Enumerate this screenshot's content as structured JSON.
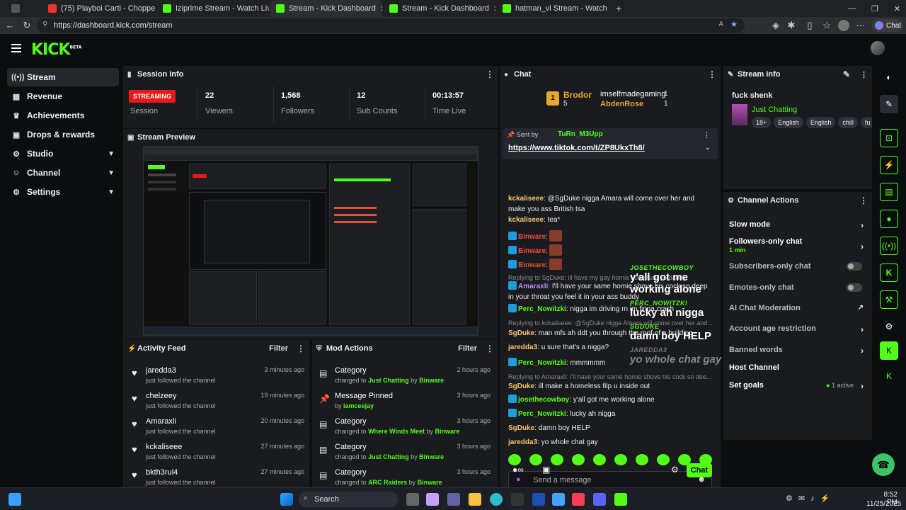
{
  "browser": {
    "tabs": [
      "(75) Playboi Carti - Chopper Righ",
      "Iziprime Stream - Watch Live on",
      "Stream - Kick Dashboard",
      "Stream - Kick Dashboard",
      "hatman_vl Stream - Watch Li"
    ],
    "url": "https://dashboard.kick.com/stream",
    "chat_btn": "Chat"
  },
  "brand": {
    "logo": "KICK",
    "beta": "BETA"
  },
  "sidebar": {
    "items": [
      {
        "label": "Stream",
        "icon": "broadcast-icon"
      },
      {
        "label": "Revenue",
        "icon": "money-icon"
      },
      {
        "label": "Achievements",
        "icon": "trophy-icon"
      },
      {
        "label": "Drops & rewards",
        "icon": "gift-icon"
      },
      {
        "label": "Studio",
        "icon": "gear-icon"
      },
      {
        "label": "Channel",
        "icon": "user-icon"
      },
      {
        "label": "Settings",
        "icon": "settings-icon"
      }
    ]
  },
  "session": {
    "title": "Session Info",
    "status": "STREAMING",
    "status_label": "Session",
    "stats": [
      {
        "value": "22",
        "label": "Viewers"
      },
      {
        "value": "1,568",
        "label": "Followers"
      },
      {
        "value": "12",
        "label": "Sub Counts"
      },
      {
        "value": "00:13:57",
        "label": "Time Live"
      }
    ]
  },
  "preview": {
    "title": "Stream Preview"
  },
  "activity": {
    "title": "Activity Feed",
    "filter": "Filter",
    "rows": [
      {
        "name": "jaredda3",
        "sub": "just followed the channel",
        "time": "3 minutes ago"
      },
      {
        "name": "chelzeey",
        "sub": "just followed the channel",
        "time": "19 minutes ago"
      },
      {
        "name": "Amaraxli",
        "sub": "just followed the channel",
        "time": "20 minutes ago"
      },
      {
        "name": "kckaliseee",
        "sub": "just followed the channel",
        "time": "27 minutes ago"
      },
      {
        "name": "bkth3rul4",
        "sub": "just followed the channel",
        "time": "27 minutes ago"
      }
    ]
  },
  "mod": {
    "title": "Mod Actions",
    "filter": "Filter",
    "rows": [
      {
        "name": "Category",
        "pre": "changed to",
        "hl": "Just Chatting",
        "by": "by",
        "who": "Binware",
        "time": "2 hours ago"
      },
      {
        "name": "Message Pinned",
        "pre": "by",
        "hl": "",
        "by": "",
        "who": "iamceejay",
        "time": "3 hours ago"
      },
      {
        "name": "Category",
        "pre": "changed to",
        "hl": "Where Winds Meet",
        "by": "by",
        "who": "Binware",
        "time": "3 hours ago"
      },
      {
        "name": "Category",
        "pre": "changed to",
        "hl": "Just Chatting",
        "by": "by",
        "who": "Binware",
        "time": "3 hours ago"
      },
      {
        "name": "Category",
        "pre": "changed to",
        "hl": "ARC Raiders",
        "by": "by",
        "who": "Binware",
        "time": "3 hours ago"
      }
    ]
  },
  "chat": {
    "title": "Chat",
    "leader": {
      "n1": "Brodor",
      "c1": "5",
      "n2": "imselfmadegaming",
      "c2": "1",
      "n3": "AbdenRose",
      "c3": "1",
      "rank": "1"
    },
    "pinned": {
      "sent": "Sent by",
      "user": "TuRn_M3Upp",
      "link": "https://www.tiktok.com/t/ZP8UkxTh8/"
    },
    "lines": [
      {
        "u": "kckaliseee",
        "c": "#f5c86a",
        "t": "@SgDuke nigga Amara will come over her and make you ass British tsa"
      },
      {
        "u": "kckaliseee",
        "c": "#f5c86a",
        "t": "tea*"
      },
      {
        "u": "Binware",
        "c": "#e94c3d",
        "t": ""
      },
      {
        "u": "Binware",
        "c": "#e94c3d",
        "t": ""
      },
      {
        "u": "Binware",
        "c": "#e94c3d",
        "t": ""
      },
      {
        "r": "Replying to SgDuke: ill have my gay homie kobe fuck yo daddy"
      },
      {
        "u": "Amaraxli",
        "c": "#c38bff",
        "t": "I'll have your same homie shove his cock so deep in your throat you feel it in your ass buddy"
      },
      {
        "u": "Perc_Nowitzki",
        "c": "#53fc18",
        "t": "nigga im driving rn im finna crash"
      },
      {
        "r": "Replying to kckaliseee: @SgDuke nigga Amara will come over her and..."
      },
      {
        "u": "SgDuke",
        "c": "#f5c86a",
        "t": "man mfs ah ddt you through the roof of a building"
      },
      {
        "u": "jaredda3",
        "c": "#f5c86a",
        "t": "u sure that's a nigga?"
      },
      {
        "u": "Perc_Nowitzki",
        "c": "#53fc18",
        "t": "mmmmmm"
      },
      {
        "r": "Replying to Amaraxli: I'll have your same homie shove his cock so dee..."
      },
      {
        "u": "SgDuke",
        "c": "#f5c86a",
        "t": "ill make a homeless filp u inside out"
      },
      {
        "u": "josethecowboy",
        "c": "#53fc18",
        "t": "y'all got me working alone"
      },
      {
        "u": "Perc_Nowitzki",
        "c": "#53fc18",
        "t": "lucky ah nigga"
      },
      {
        "u": "SgDuke",
        "c": "#f5c86a",
        "t": "damn boy HELP"
      },
      {
        "u": "jaredda3",
        "c": "#f5c86a",
        "t": "yo whole chat gay"
      }
    ],
    "placeholder": "Send a message",
    "send": "Chat"
  },
  "streaminfo": {
    "title": "Stream info",
    "stream_title": "fuck shenk",
    "category": "Just Chatting",
    "tags": [
      "18+",
      "English",
      "English",
      "chill",
      "fu"
    ]
  },
  "actions": {
    "title": "Channel Actions",
    "rows": [
      {
        "label": "Slow mode",
        "sub": "",
        "kind": "arrow"
      },
      {
        "label": "Followers-only chat",
        "sub": "1 min",
        "kind": "arrow"
      },
      {
        "label": "Subscribers-only chat",
        "sub": "",
        "kind": "toggle"
      },
      {
        "label": "Emotes-only chat",
        "sub": "",
        "kind": "toggle"
      },
      {
        "label": "AI Chat Moderation",
        "sub": "",
        "kind": "ext"
      },
      {
        "label": "Account age restriction",
        "sub": "",
        "kind": "arrow"
      },
      {
        "label": "Banned words",
        "sub": "",
        "kind": "arrow"
      },
      {
        "label": "Host Channel",
        "sub": "",
        "kind": "none"
      },
      {
        "label": "Set goals",
        "sub": "1 active",
        "kind": "arrow"
      }
    ]
  },
  "overlay": [
    {
      "u": "JOSETHECOWBOY",
      "m": "y'all got me working alone"
    },
    {
      "u": "PERC_NOWITZKI",
      "m": "lucky ah nigga"
    },
    {
      "u": "SGDUKE",
      "m": "damn boy HELP"
    },
    {
      "u": "JAREDDA3",
      "m": "yo whole chat gay"
    }
  ],
  "taskbar": {
    "search": "Search",
    "time": "8:52 PM",
    "date": "11/25/2025"
  },
  "colors": {
    "accent": "#53fc18",
    "live": "#e91916",
    "panel": "#191b1f"
  }
}
